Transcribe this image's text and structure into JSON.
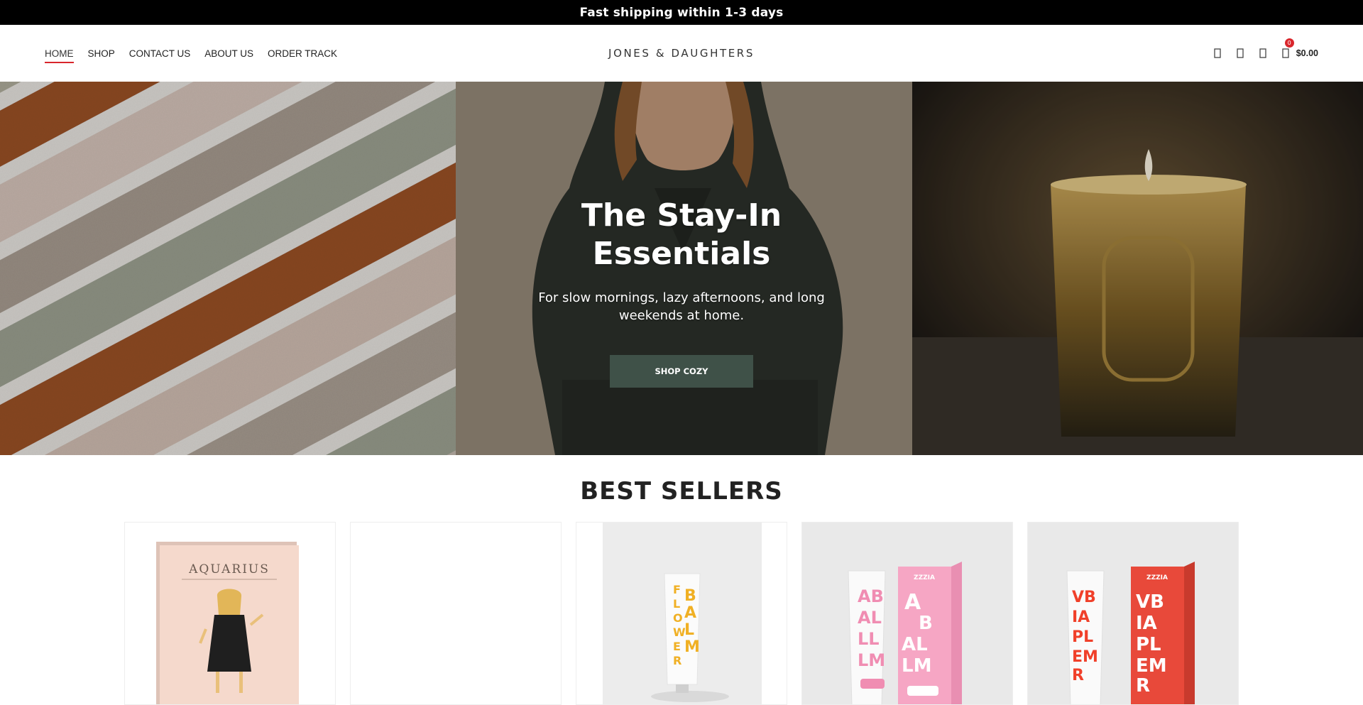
{
  "announcement": {
    "text": "Fast shipping within 1-3 days"
  },
  "nav": {
    "items": [
      {
        "label": "HOME",
        "active": true
      },
      {
        "label": "SHOP",
        "active": false
      },
      {
        "label": "CONTACT US",
        "active": false
      },
      {
        "label": "ABOUT US",
        "active": false
      },
      {
        "label": "ORDER TRACK",
        "active": false
      }
    ]
  },
  "brand": {
    "name": "JONES & DAUGHTERS"
  },
  "header_tools": {
    "icons": [
      "search-icon",
      "user-icon",
      "heart-icon"
    ],
    "cart": {
      "count": "0",
      "total": "$0.00",
      "icon": "shopping-bag-icon"
    }
  },
  "hero": {
    "title": "The Stay-In Essentials",
    "subtitle": "For slow mornings, lazy afternoons, and long weekends at home.",
    "cta_label": "SHOP COZY"
  },
  "best_sellers": {
    "title": "BEST SELLERS",
    "products": [
      {
        "image": "aquarius-card",
        "text": "AQUARIUS"
      },
      {
        "image": "blank"
      },
      {
        "image": "flower-balm-tube",
        "text": "FLOWER BALM"
      },
      {
        "image": "rose-balm-tube",
        "text": "ABALL LM"
      },
      {
        "image": "viper-balm-tube",
        "text": "VIPER BALM"
      }
    ]
  },
  "colors": {
    "accent": "#d9262c",
    "cta": "#3f5148",
    "announce_bg": "#000000"
  }
}
